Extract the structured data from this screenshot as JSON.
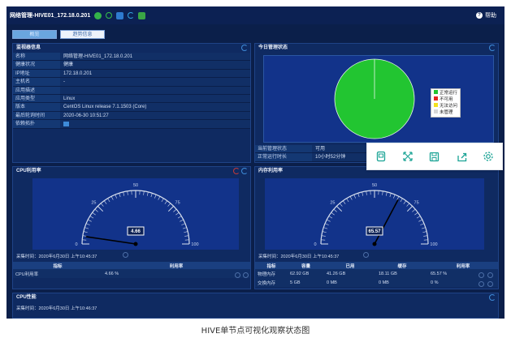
{
  "window": {
    "title": "网络管理-HIVE01_172.18.0.201",
    "help_label": "帮助"
  },
  "tabs": [
    {
      "label": "概览",
      "active": true
    },
    {
      "label": "趋势信息",
      "active": false
    }
  ],
  "monitor_info": {
    "title": "监视器信息",
    "rows": [
      {
        "key": "名称",
        "value": "网络管理-HIVE01_172.18.0.201"
      },
      {
        "key": "健康状况",
        "value": "健康"
      },
      {
        "key": "IP地址",
        "value": "172.18.0.201"
      },
      {
        "key": "主机名",
        "value": "-"
      },
      {
        "key": "应用描述",
        "value": ""
      },
      {
        "key": "应用类型",
        "value": "Linux"
      },
      {
        "key": "版本",
        "value": "CentOS Linux release 7.1.1503 (Core)"
      },
      {
        "key": "最后轮询时间",
        "value": "2020-06-30 10:51:27"
      },
      {
        "key": "依赖拓扑",
        "value": ""
      }
    ]
  },
  "today_status": {
    "title": "今日管理状态",
    "legend": [
      {
        "label": "正常运行",
        "color": "#22c531"
      },
      {
        "label": "不可用",
        "color": "#e52420"
      },
      {
        "label": "无法访问",
        "color": "#f4e21d"
      },
      {
        "label": "未管理",
        "color": "#d7d7d7"
      }
    ],
    "pie_values": {
      "正常运行": 100,
      "不可用": 0,
      "无法访问": 0,
      "未管理": 0
    },
    "status_rows": [
      {
        "key": "当前管理状态",
        "value": "可用"
      },
      {
        "key": "正常运行时长",
        "value": "10小时52分钟"
      }
    ]
  },
  "cpu": {
    "title": "CPU利用率",
    "value": 4.66,
    "value_label": "4.66",
    "gauge_min": 0,
    "gauge_max": 100,
    "ticks": [
      "0",
      "25",
      "50",
      "75",
      "100"
    ],
    "sample_time": "采集时间：2020年6月30日 上午10:45:37",
    "table_headers": [
      "指标",
      "利用率"
    ],
    "table_rows": [
      {
        "name": "CPU利用率",
        "value": "4.66 %"
      }
    ]
  },
  "memory": {
    "title": "内存利用率",
    "value": 65.57,
    "value_label": "65.57",
    "gauge_min": 0,
    "gauge_max": 100,
    "ticks": [
      "0",
      "25",
      "50",
      "75",
      "100"
    ],
    "sample_time": "采集时间：2020年6月30日 上午10:45:37",
    "table_headers": [
      "指标",
      "容量",
      "已用",
      "缓存",
      "利用率"
    ],
    "table_rows": [
      {
        "name": "物理内存",
        "capacity": "62.92 GB",
        "used": "41.26 GB",
        "cache": "18.11 GB",
        "rate": "65.57 %"
      },
      {
        "name": "交换内存",
        "capacity": "5 GB",
        "used": "0 MB",
        "cache": "0 MB",
        "rate": "0 %"
      }
    ]
  },
  "cpu_perf": {
    "title": "CPU性能",
    "sample_time": "采集时间：2020年6月30日 上午10:46:37"
  },
  "caption": "HIVE单节点可视化观察状态图"
}
